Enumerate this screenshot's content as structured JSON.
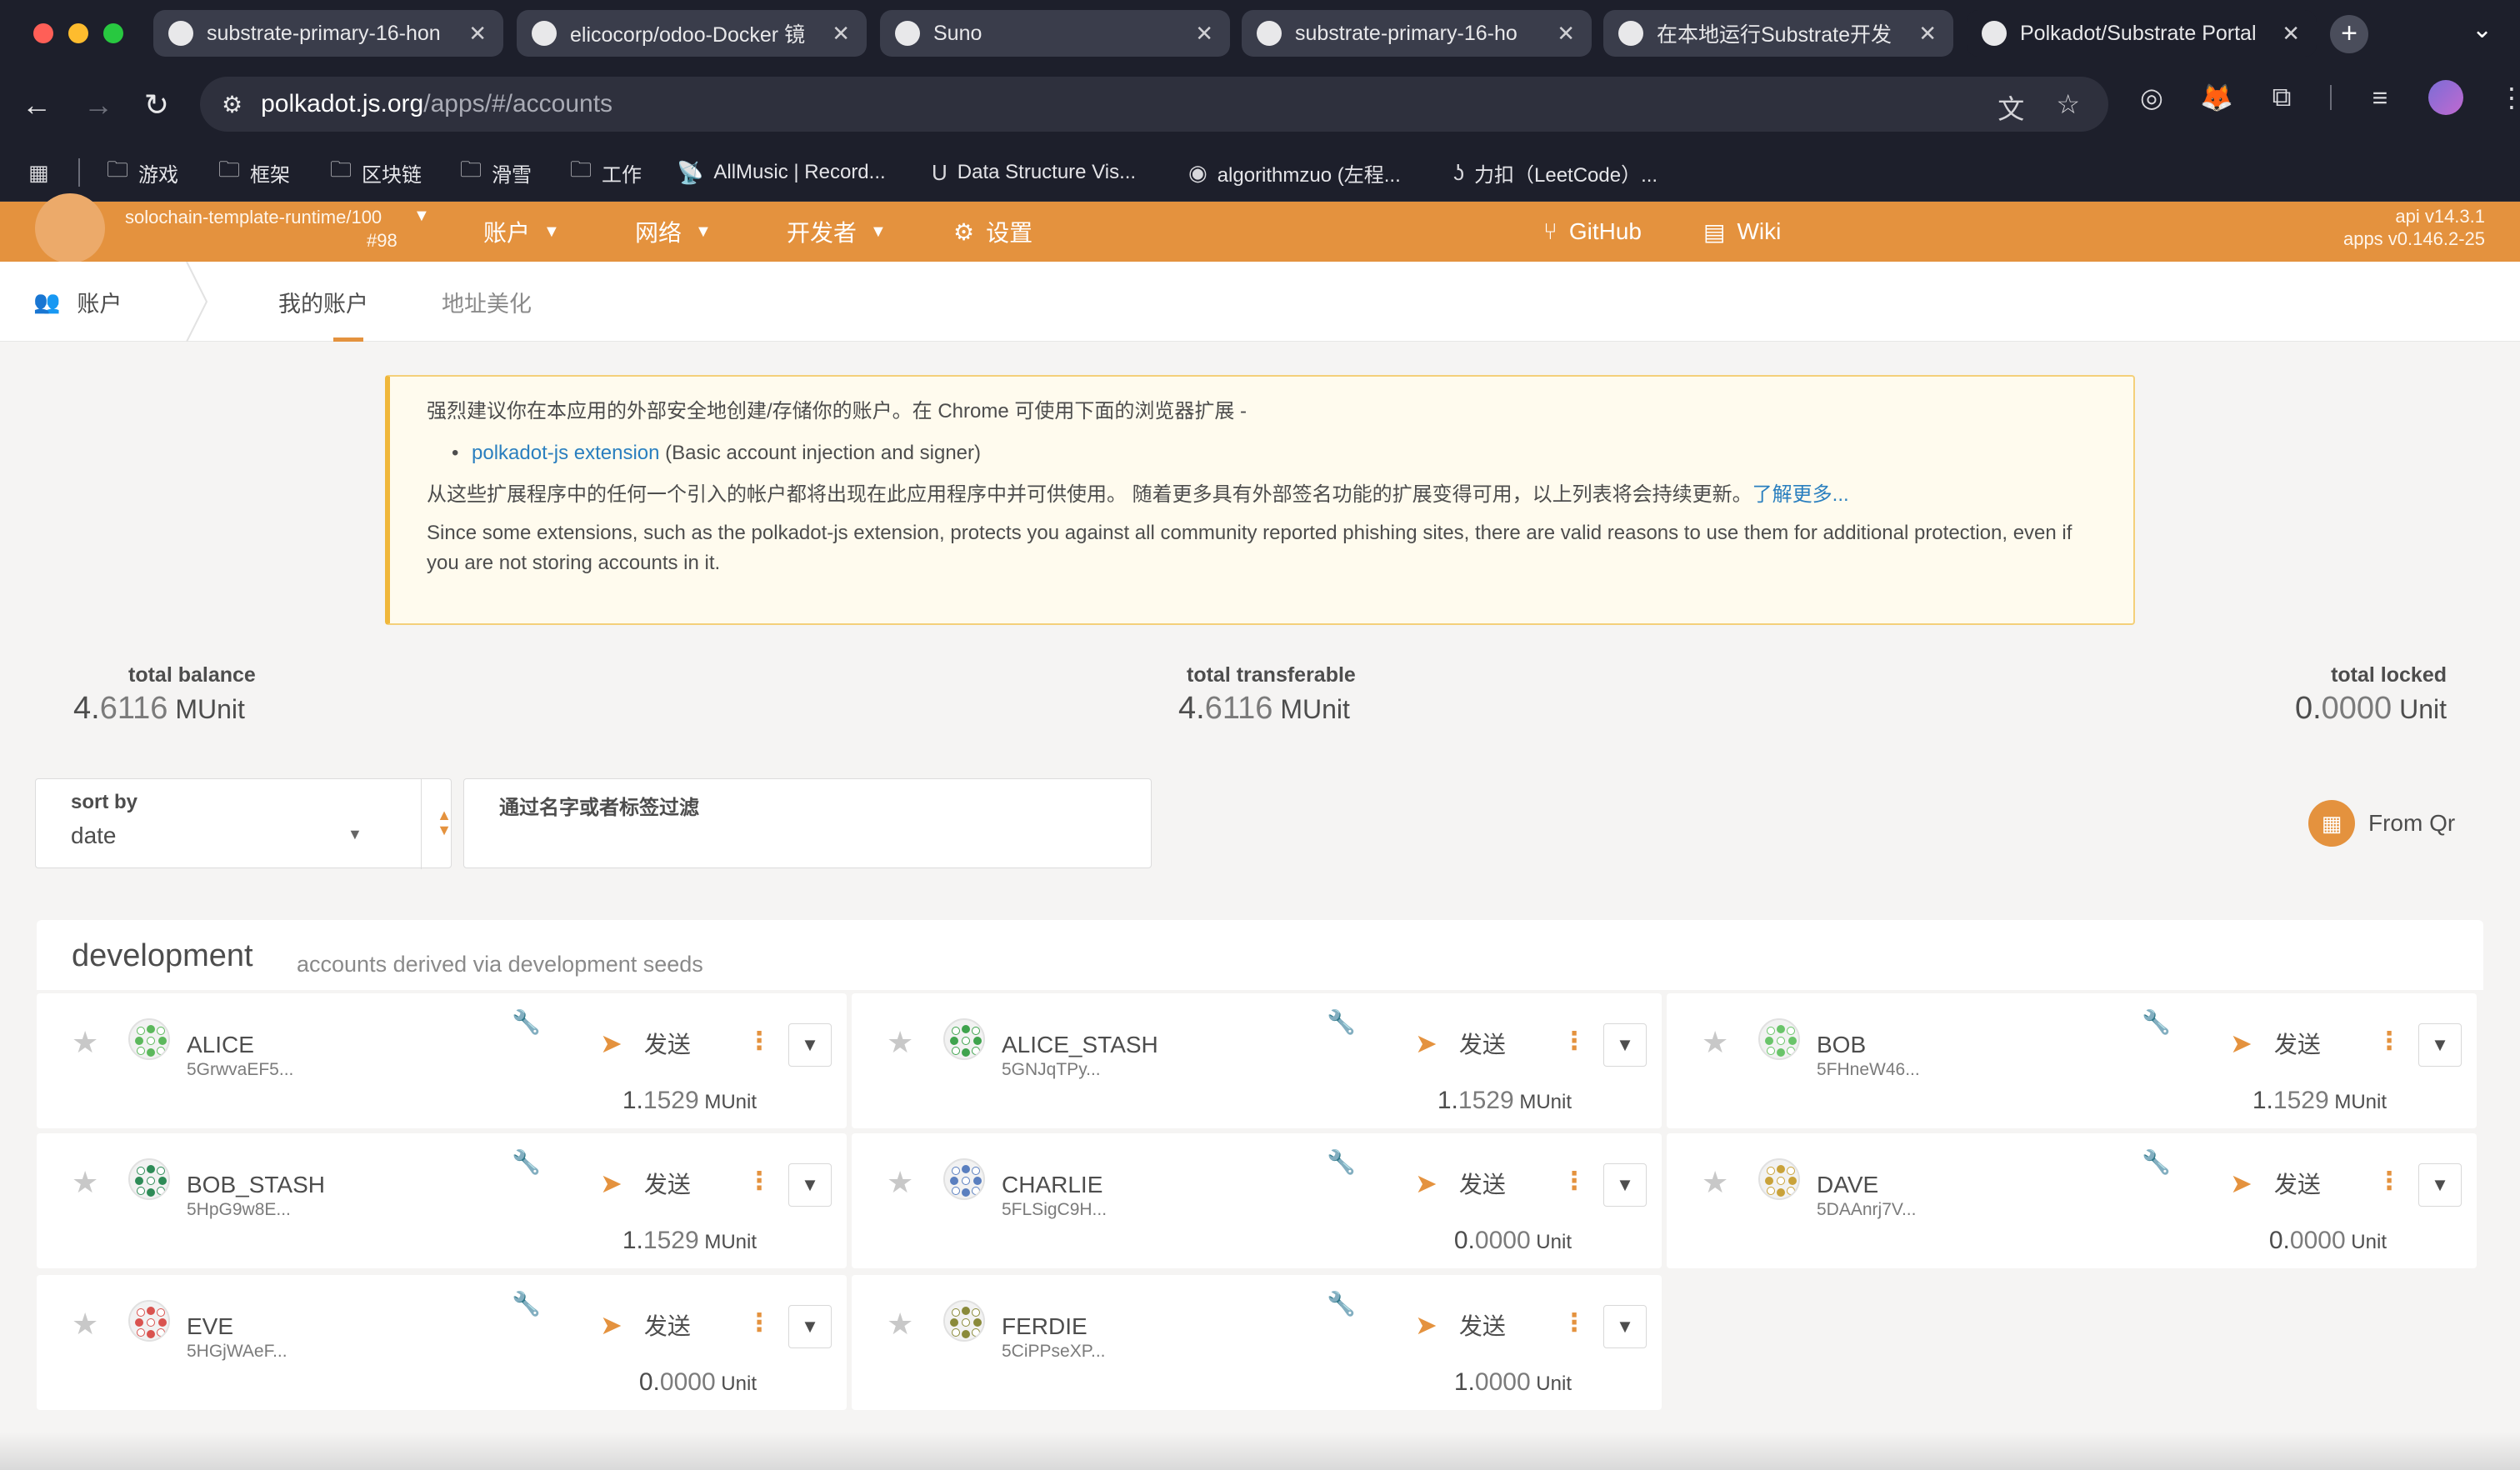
{
  "browser": {
    "tabs": [
      {
        "title": "substrate-primary-16-hon",
        "active": false
      },
      {
        "title": "elicocorp/odoo-Docker 镜",
        "active": false
      },
      {
        "title": "Suno",
        "active": false
      },
      {
        "title": "substrate-primary-16-ho",
        "active": false
      },
      {
        "title": "在本地运行Substrate开发",
        "active": false
      },
      {
        "title": "Polkadot/Substrate Portal",
        "active": true
      }
    ],
    "url_host": "polkadot.js.org",
    "url_path": "/apps/#/accounts",
    "bookmarks": [
      {
        "label": "游戏",
        "icon": "folder-icon"
      },
      {
        "label": "框架",
        "icon": "folder-icon"
      },
      {
        "label": "区块链",
        "icon": "folder-icon"
      },
      {
        "label": "滑雪",
        "icon": "folder-icon"
      },
      {
        "label": "工作",
        "icon": "folder-icon"
      },
      {
        "label": "AllMusic | Record...",
        "icon": "antenna-icon"
      },
      {
        "label": "Data Structure Vis...",
        "icon": "usf-icon"
      },
      {
        "label": "algorithmzuo (左程...",
        "icon": "github-icon"
      },
      {
        "label": "力扣（LeetCode）...",
        "icon": "leetcode-icon"
      }
    ]
  },
  "app": {
    "chain_name": "solochain-template-runtime/100",
    "chain_block": "#98",
    "menu": {
      "accounts": "账户",
      "network": "网络",
      "developer": "开发者",
      "settings": "设置",
      "github": "GitHub",
      "wiki": "Wiki"
    },
    "version_api": "api v14.3.1",
    "version_apps": "apps v0.146.2-25"
  },
  "subnav": {
    "section": "账户",
    "tabs": [
      "我的账户",
      "地址美化"
    ]
  },
  "warning": {
    "line1": "强烈建议你在本应用的外部安全地创建/存储你的账户。在 Chrome 可使用下面的浏览器扩展 -",
    "ext_link": "polkadot-js extension",
    "ext_desc": " (Basic account injection and signer)",
    "line3": "从这些扩展程序中的任何一个引入的帐户都将出现在此应用程序中并可供使用。 随着更多具有外部签名功能的扩展变得可用，以上列表将会持续更新。",
    "learn_more": "了解更多...",
    "line4": "Since some extensions, such as the polkadot-js extension, protects you against all community reported phishing sites, there are valid reasons to use them for additional protection, even if you are not storing accounts in it."
  },
  "balances": {
    "total_balance": {
      "label": "total balance",
      "int": "4.",
      "dec": "6116",
      "unit": " MUnit"
    },
    "total_transferable": {
      "label": "total transferable",
      "int": "4.",
      "dec": "6116",
      "unit": " MUnit"
    },
    "total_locked": {
      "label": "total locked",
      "int": "0.",
      "dec": "0000",
      "unit": " Unit"
    }
  },
  "filters": {
    "sort_label": "sort by",
    "sort_value": "date",
    "filter_label": "通过名字或者标签过滤",
    "from_qr": "From Qr"
  },
  "development": {
    "title": "development",
    "subtitle": "accounts derived via development seeds",
    "send_label": "发送",
    "accounts": [
      {
        "name": "ALICE",
        "address": "5GrwvaEF5...",
        "int": "1.",
        "dec": "1529",
        "unit": " MUnit",
        "color": "#5cb85c"
      },
      {
        "name": "ALICE_STASH",
        "address": "5GNJqTPy...",
        "int": "1.",
        "dec": "1529",
        "unit": " MUnit",
        "color": "#3fa34d"
      },
      {
        "name": "BOB",
        "address": "5FHneW46...",
        "int": "1.",
        "dec": "1529",
        "unit": " MUnit",
        "color": "#6ac46a"
      },
      {
        "name": "BOB_STASH",
        "address": "5HpG9w8E...",
        "int": "1.",
        "dec": "1529",
        "unit": " MUnit",
        "color": "#2e8b57"
      },
      {
        "name": "CHARLIE",
        "address": "5FLSigC9H...",
        "int": "0.",
        "dec": "0000",
        "unit": " Unit",
        "color": "#5a7fbf"
      },
      {
        "name": "DAVE",
        "address": "5DAAnrj7V...",
        "int": "0.",
        "dec": "0000",
        "unit": " Unit",
        "color": "#c9a23a"
      },
      {
        "name": "EVE",
        "address": "5HGjWAeF...",
        "int": "0.",
        "dec": "0000",
        "unit": " Unit",
        "color": "#d9534f"
      },
      {
        "name": "FERDIE",
        "address": "5CiPPseXP...",
        "int": "1.",
        "dec": "0000",
        "unit": " Unit",
        "color": "#8a8a3a"
      }
    ]
  },
  "colors": {
    "accent": "#e4923e",
    "link": "#2a7fbf",
    "warning_border": "#f0b73a"
  }
}
